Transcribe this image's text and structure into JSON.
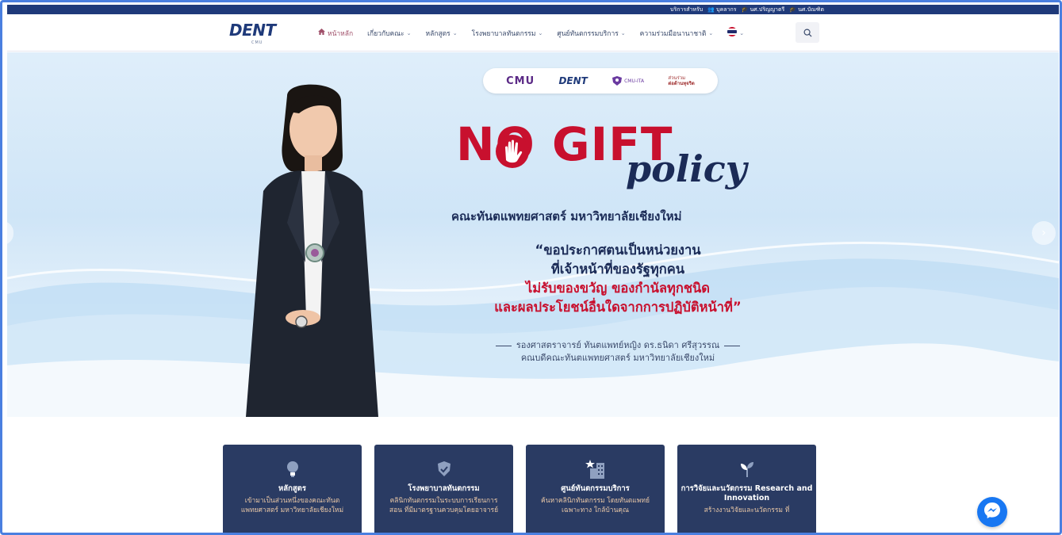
{
  "utilbar": {
    "label": "บริการสำหรับ",
    "links": [
      "บุคลากร",
      "นศ.ปริญญาตรี",
      "นศ.บัณฑิต"
    ]
  },
  "nav": {
    "logo": "DENT",
    "logo_sub": "CMU",
    "menu": [
      {
        "label": "หน้าหลัก",
        "active": true,
        "icon": "home-icon"
      },
      {
        "label": "เกี่ยวกับคณะ",
        "dropdown": true
      },
      {
        "label": "หลักสูตร",
        "dropdown": true
      },
      {
        "label": "โรงพยาบาลทันตกรรม",
        "dropdown": true
      },
      {
        "label": "ศูนย์ทันตกรรมบริการ",
        "dropdown": true
      },
      {
        "label": "ความร่วมมือนานาชาติ",
        "dropdown": true
      }
    ],
    "language_icon": "thai-flag-icon"
  },
  "hero": {
    "partners": {
      "cmu": "CMU",
      "cmu_sub": "CHIANG MAI UNIVERSITY",
      "dent": "DENT",
      "ita": "CMU-ITA",
      "anti1": "ต่อต้านทุจริต",
      "anti_top": "ส่วนร่วม"
    },
    "headline": "NO GIFT",
    "headline_script": "policy",
    "faculty": "คณะทันตแพทยศาสตร์ มหาวิทยาลัยเชียงใหม่",
    "quote_lines": [
      {
        "text": "“ขอประกาศตนเป็นหน่วยงาน",
        "color": "navy"
      },
      {
        "text": "ที่เจ้าหน้าที่ของรัฐทุกคน",
        "color": "navy"
      },
      {
        "text": "ไม่รับของขวัญ ของกำนัลทุกชนิด",
        "color": "red"
      },
      {
        "text": "และผลประโยชน์อื่นใดจากการปฏิบัติหน้าที่”",
        "color": "red"
      }
    ],
    "signer_name": "รองศาสตราจารย์ ทันตแพทย์หญิง ดร.ธนิดา ศรีสุวรรณ",
    "signer_title": "คณบดีคณะทันตแพทยศาสตร์ มหาวิทยาลัยเชียงใหม่"
  },
  "cards": [
    {
      "icon": "lightbulb-icon",
      "title": "หลักสูตร",
      "desc": "เข้ามาเป็นส่วนหนึ่งของคณะทันตแพทยศาสตร์ มหาวิทยาลัยเชียงใหม่"
    },
    {
      "icon": "shield-check-icon",
      "title": "โรงพยาบาลทันตกรรม",
      "desc": "คลินิกทันตกรรมในระบบการเรียนการสอน ที่มีมาตรฐานควบคุมโดยอาจารย์"
    },
    {
      "icon": "building-star-icon",
      "title": "ศูนย์ทันตกรรมบริการ",
      "desc": "ค้นหาคลินิกทันตกรรม โดยทันตแพทย์เฉพาะทาง ใกล้บ้านคุณ"
    },
    {
      "icon": "sprout-icon",
      "title": "การวิจัยและนวัตกรรม Research and Innovation",
      "desc": "สร้างงานวิจัยและนวัตกรรม ที่"
    }
  ]
}
